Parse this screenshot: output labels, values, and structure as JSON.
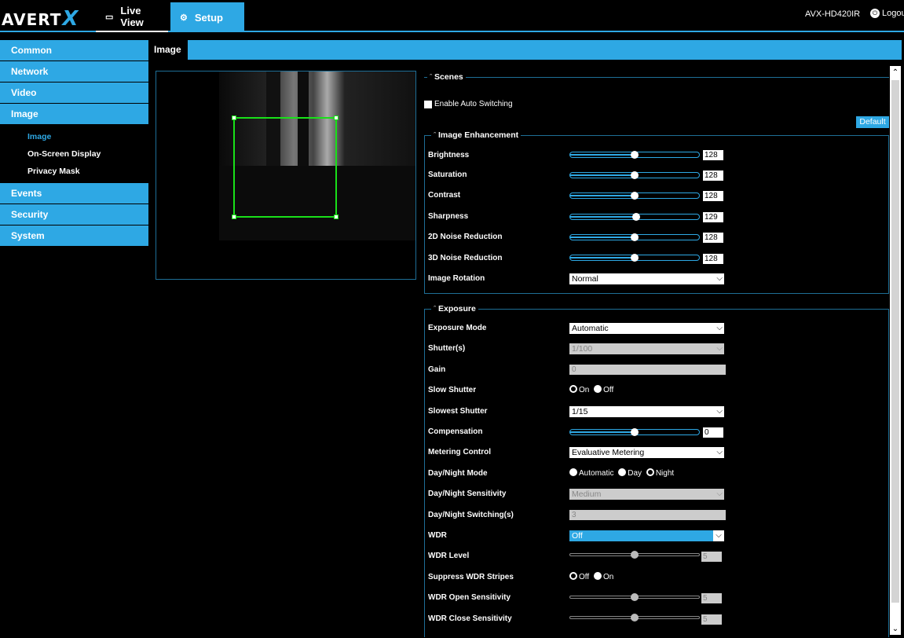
{
  "app": {
    "brand_prefix": "AVERT",
    "brand_suffix": "X",
    "device_name": "AVX-HD420IR",
    "logout_label": "Logou"
  },
  "nav": {
    "live_view": "Live View",
    "setup": "Setup"
  },
  "sidebar": {
    "items": [
      {
        "label": "Common"
      },
      {
        "label": "Network"
      },
      {
        "label": "Video"
      },
      {
        "label": "Image"
      },
      {
        "label": "Events"
      },
      {
        "label": "Security"
      },
      {
        "label": "System"
      }
    ],
    "image_sub": [
      {
        "label": "Image",
        "active": true
      },
      {
        "label": "On-Screen Display"
      },
      {
        "label": "Privacy Mask"
      }
    ]
  },
  "page": {
    "tab": "Image"
  },
  "scenes": {
    "title": "Scenes",
    "auto_switch_label": "Enable Auto Switching",
    "default_button": "Default"
  },
  "enhancement": {
    "title": "Image Enhancement",
    "sliders": [
      {
        "label": "Brightness",
        "value": "128",
        "fraction": 0.5
      },
      {
        "label": "Saturation",
        "value": "128",
        "fraction": 0.5
      },
      {
        "label": "Contrast",
        "value": "128",
        "fraction": 0.5
      },
      {
        "label": "Sharpness",
        "value": "129",
        "fraction": 0.51
      },
      {
        "label": "2D Noise Reduction",
        "value": "128",
        "fraction": 0.5
      },
      {
        "label": "3D Noise Reduction",
        "value": "128",
        "fraction": 0.5
      }
    ],
    "rotation_label": "Image Rotation",
    "rotation_value": "Normal"
  },
  "exposure": {
    "title": "Exposure",
    "mode_label": "Exposure Mode",
    "mode_value": "Automatic",
    "shutter_label": "Shutter(s)",
    "shutter_value": "1/100",
    "gain_label": "Gain",
    "gain_value": "0",
    "slow_shutter_label": "Slow Shutter",
    "slow_shutter_on": "On",
    "slow_shutter_off": "Off",
    "slowest_shutter_label": "Slowest Shutter",
    "slowest_shutter_value": "1/15",
    "compensation_label": "Compensation",
    "compensation_value": "0",
    "metering_label": "Metering Control",
    "metering_value": "Evaluative Metering",
    "daynight_label": "Day/Night Mode",
    "daynight_auto": "Automatic",
    "daynight_day": "Day",
    "daynight_night": "Night",
    "sensitivity_label": "Day/Night Sensitivity",
    "sensitivity_value": "Medium",
    "switching_label": "Day/Night Switching(s)",
    "switching_value": "3",
    "wdr_label": "WDR",
    "wdr_value": "Off",
    "wdr_level_label": "WDR Level",
    "wdr_level_value": "5",
    "suppress_label": "Suppress WDR Stripes",
    "suppress_off": "Off",
    "suppress_on": "On",
    "wdr_open_label": "WDR Open Sensitivity",
    "wdr_open_value": "5",
    "wdr_close_label": "WDR Close Sensitivity",
    "wdr_close_value": "5"
  }
}
